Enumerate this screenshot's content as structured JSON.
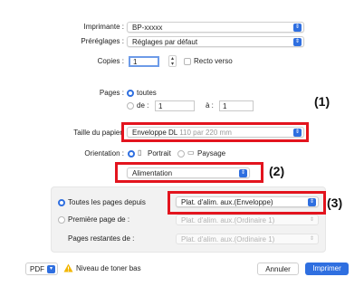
{
  "printer": {
    "label": "Imprimante :",
    "value": "BP-xxxxx"
  },
  "presets": {
    "label": "Préréglages :",
    "value": "Réglages par défaut"
  },
  "copies": {
    "label": "Copies :",
    "value": "1",
    "duplex_label": "Recto verso"
  },
  "pages": {
    "label": "Pages :",
    "all_label": "toutes",
    "from_label": "de :",
    "from_value": "1",
    "to_label": "à :",
    "to_value": "1"
  },
  "paper_size": {
    "label": "Taille du papier",
    "value": "Enveloppe DL",
    "dimensions": "110 par 220 mm"
  },
  "orientation": {
    "label": "Orientation :",
    "portrait": "Portrait",
    "landscape": "Paysage"
  },
  "section_menu": {
    "value": "Alimentation"
  },
  "feed": {
    "all_pages_label": "Toutes les pages depuis",
    "all_pages_value": "Plat. d'alim. aux.(Enveloppe)",
    "first_page_label": "Première page de :",
    "first_page_value": "Plat. d'alim. aux.(Ordinaire 1)",
    "remaining_label": "Pages restantes de :",
    "remaining_value": "Plat. d'alim. aux.(Ordinaire 1)"
  },
  "callouts": [
    "(1)",
    "(2)",
    "(3)"
  ],
  "footer": {
    "pdf_label": "PDF",
    "toner_warning": "Niveau de toner bas",
    "cancel_label": "Annuler",
    "print_label": "Imprimer"
  },
  "colors": {
    "accent": "#2f6fe0",
    "highlight": "#e3141e",
    "warning": "#f2b600"
  }
}
